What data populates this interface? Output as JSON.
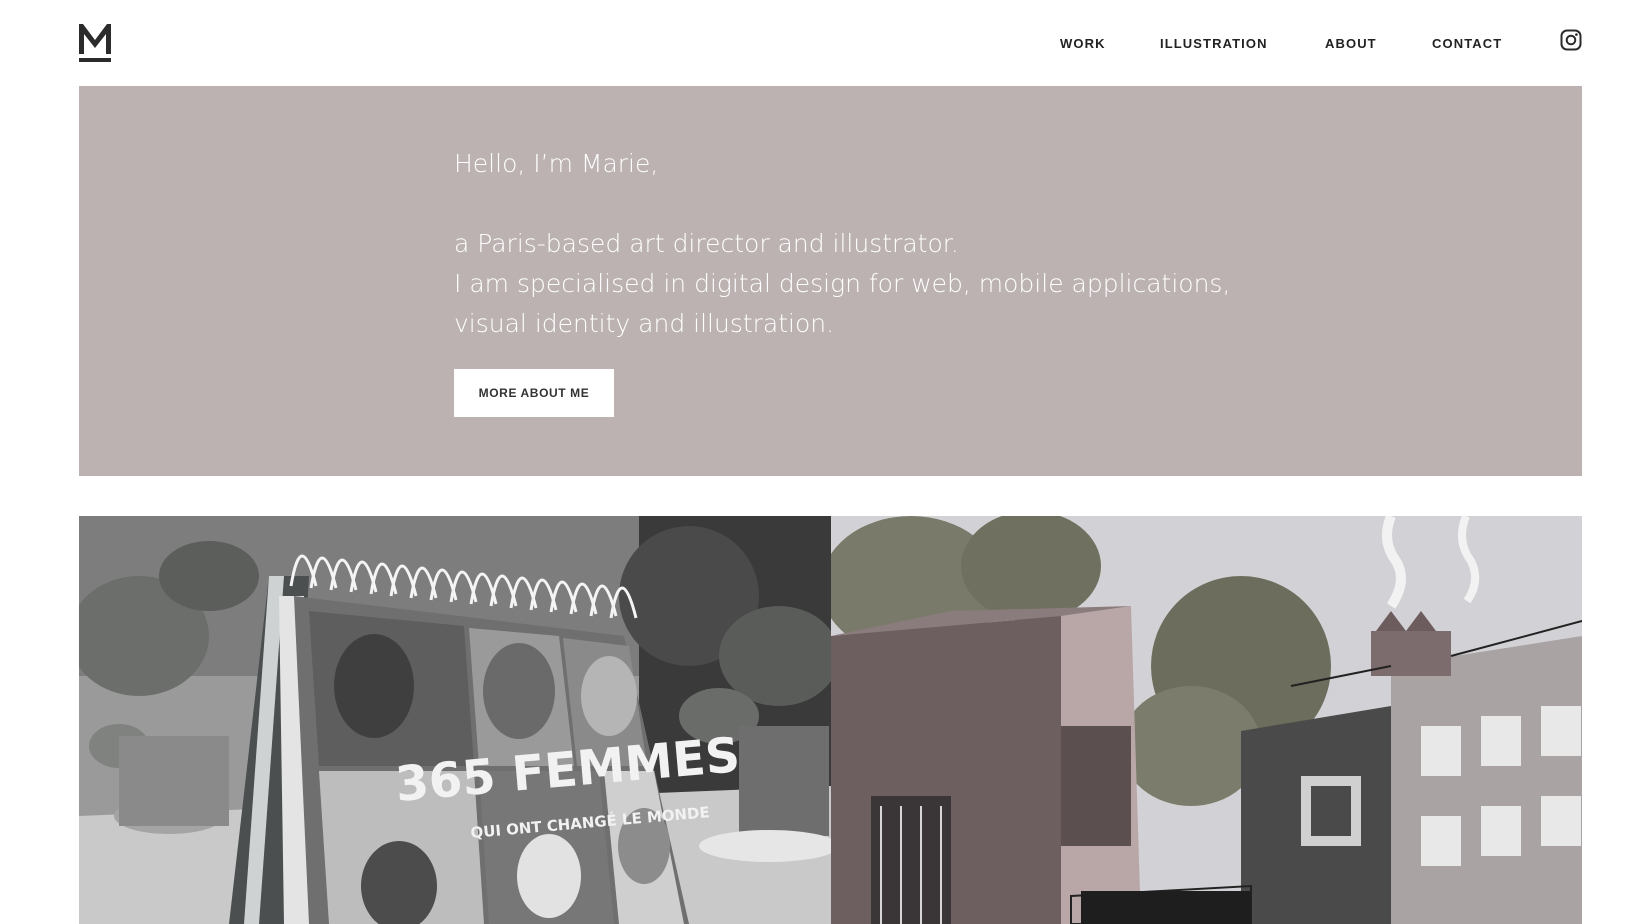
{
  "brand": {
    "logo_letter": "M"
  },
  "nav": {
    "items": [
      {
        "label": "WORK"
      },
      {
        "label": "ILLUSTRATION"
      },
      {
        "label": "ABOUT"
      },
      {
        "label": "CONTACT"
      }
    ],
    "instagram_icon": "instagram-icon"
  },
  "hero": {
    "greeting": "Hello, I’m Marie,",
    "line1": "a Paris-based art director and illustrator.",
    "line2": "I am specialised in digital design for web, mobile applications,",
    "line3": "visual identity and illustration.",
    "button_label": "MORE ABOUT ME",
    "background_color": "#bcb2b2"
  },
  "projects": [
    {
      "cover_title": "365 FEMMES",
      "cover_subtitle": "QUI ONT CHANGÉ LE MONDE"
    },
    {
      "image": "city-buildings-illustration"
    }
  ]
}
